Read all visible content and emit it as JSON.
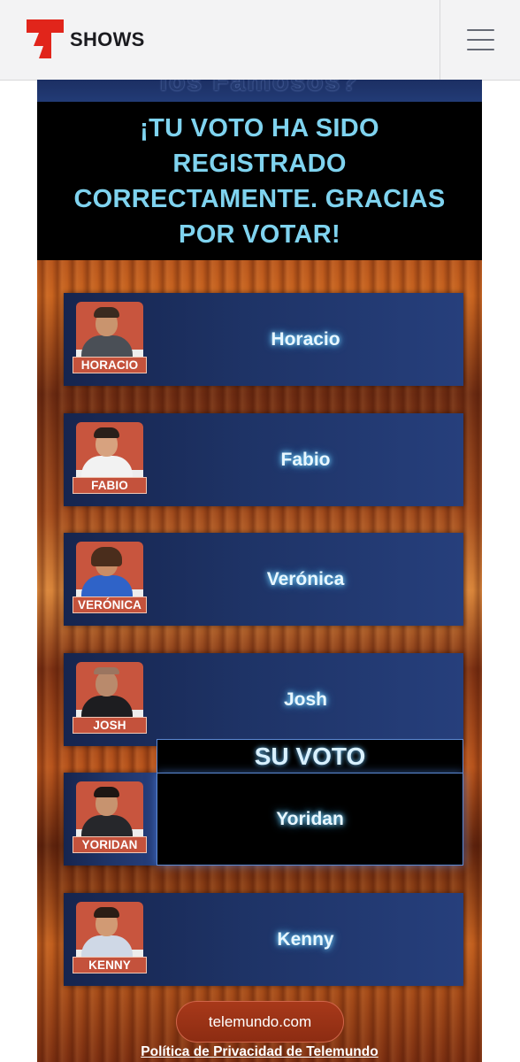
{
  "header": {
    "brand_label": "SHOWS",
    "brand_color": "#e1251b"
  },
  "vote": {
    "banner_partial_text": "los Famosos?",
    "thanks_message": "¡TU VOTO HA SIDO REGISTRADO CORRECTAMENTE. GRACIAS POR VOTAR!",
    "voted_label": "SU VOTO"
  },
  "contestants": [
    {
      "name": "Horacio",
      "badge": "HORACIO"
    },
    {
      "name": "Fabio",
      "badge": "FABIO"
    },
    {
      "name": "Verónica",
      "badge": "VERÓNICA"
    },
    {
      "name": "Josh",
      "badge": "JOSH"
    },
    {
      "name": "Yoridan",
      "badge": "YORIDAN"
    },
    {
      "name": "Kenny",
      "badge": "KENNY"
    }
  ],
  "footer": {
    "site_button": "telemundo.com",
    "privacy_link": "Política de Privacidad de Telemundo"
  }
}
